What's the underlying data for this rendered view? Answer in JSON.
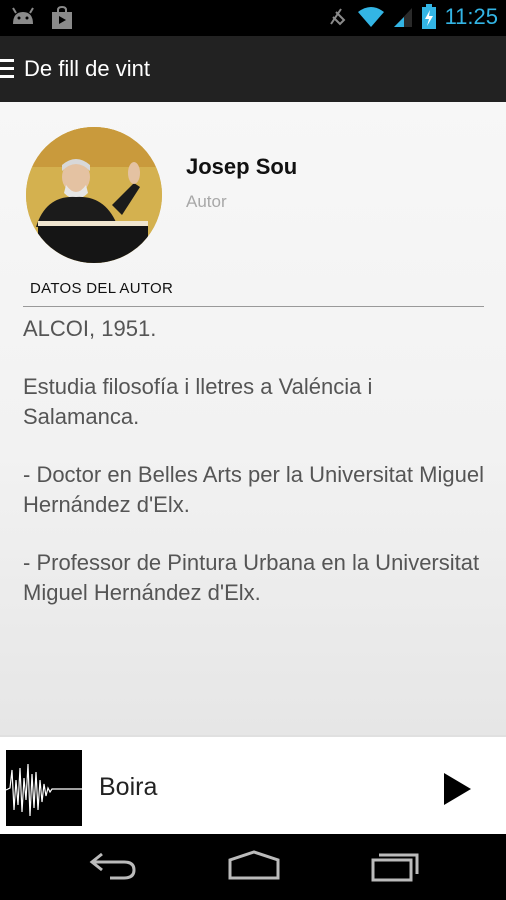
{
  "status_bar": {
    "time": "11:25",
    "left_icons": [
      "android-debug-icon",
      "shopping-bag-icon"
    ],
    "right_icons": [
      "vibrate-icon",
      "wifi-icon",
      "signal-icon",
      "battery-charging-icon"
    ],
    "accent_color": "#33b5e5"
  },
  "action_bar": {
    "title": "De fill de vint",
    "menu_icon": "hamburger-menu-icon"
  },
  "author": {
    "name": "Josep Sou",
    "role": "Autor",
    "section_label": "DATOS DEL AUTOR",
    "bio": [
      "ALCOI, 1951.",
      "Estudia filosofía i lletres a Valéncia i Salamanca.",
      "- Doctor en Belles Arts per la Universitat Miguel Hernández d'Elx.",
      "- Professor de Pintura Urbana en la Universitat Miguel Hernández d'Elx."
    ]
  },
  "player": {
    "track_title": "Boira",
    "play_icon": "play-icon",
    "thumbnail_icon": "waveform-thumbnail"
  },
  "nav_bar": {
    "buttons": [
      "back-icon",
      "home-icon",
      "recent-apps-icon"
    ]
  }
}
